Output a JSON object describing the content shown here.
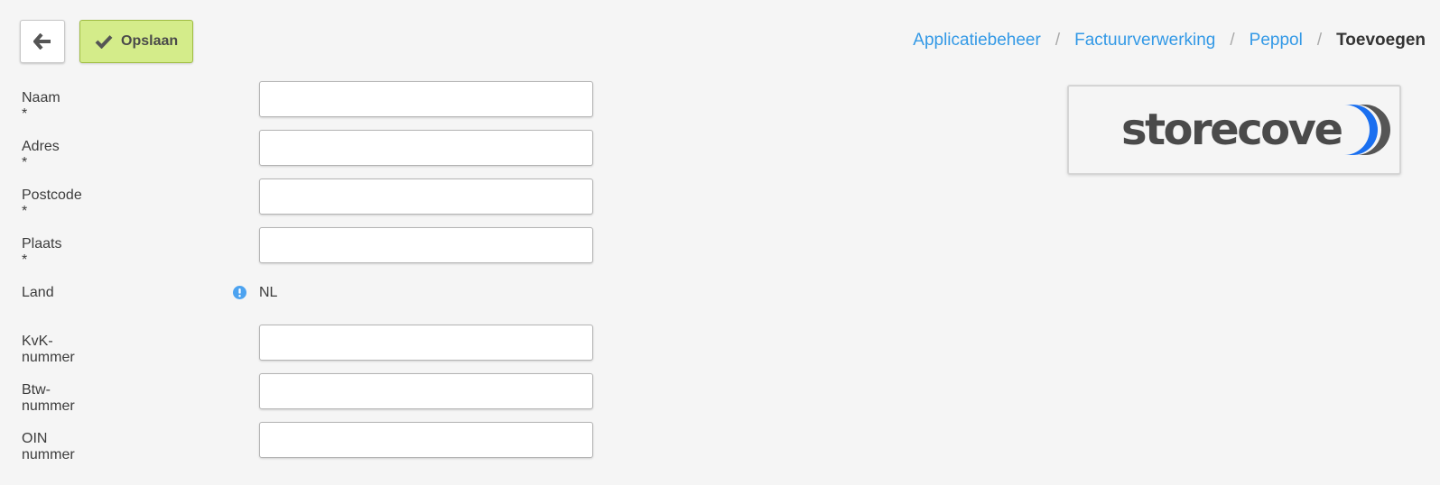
{
  "toolbar": {
    "back_icon": "arrow-left-icon",
    "save_icon": "checkmark-icon",
    "save_label": "Opslaan"
  },
  "breadcrumb": {
    "items": [
      "Applicatiebeheer",
      "Factuurverwerking",
      "Peppol"
    ],
    "separator": "/",
    "current": "Toevoegen"
  },
  "form": {
    "naam": {
      "label": "Naam *",
      "value": ""
    },
    "adres": {
      "label": "Adres *",
      "value": ""
    },
    "postcode": {
      "label": "Postcode *",
      "value": ""
    },
    "plaats": {
      "label": "Plaats *",
      "value": ""
    },
    "land": {
      "label": "Land",
      "value": "NL",
      "icon": "info-icon"
    },
    "kvk": {
      "label": "KvK-nummer",
      "value": ""
    },
    "btw": {
      "label": "Btw-nummer",
      "value": ""
    },
    "oin": {
      "label": "OIN nummer",
      "value": ""
    }
  },
  "logo": {
    "text": "storecove"
  },
  "colors": {
    "link": "#3399e6",
    "save_button": "#d4ec8a",
    "info_icon": "#4da3f0",
    "logo_text": "#4a4a4a",
    "logo_accent": "#1a6ff0"
  }
}
